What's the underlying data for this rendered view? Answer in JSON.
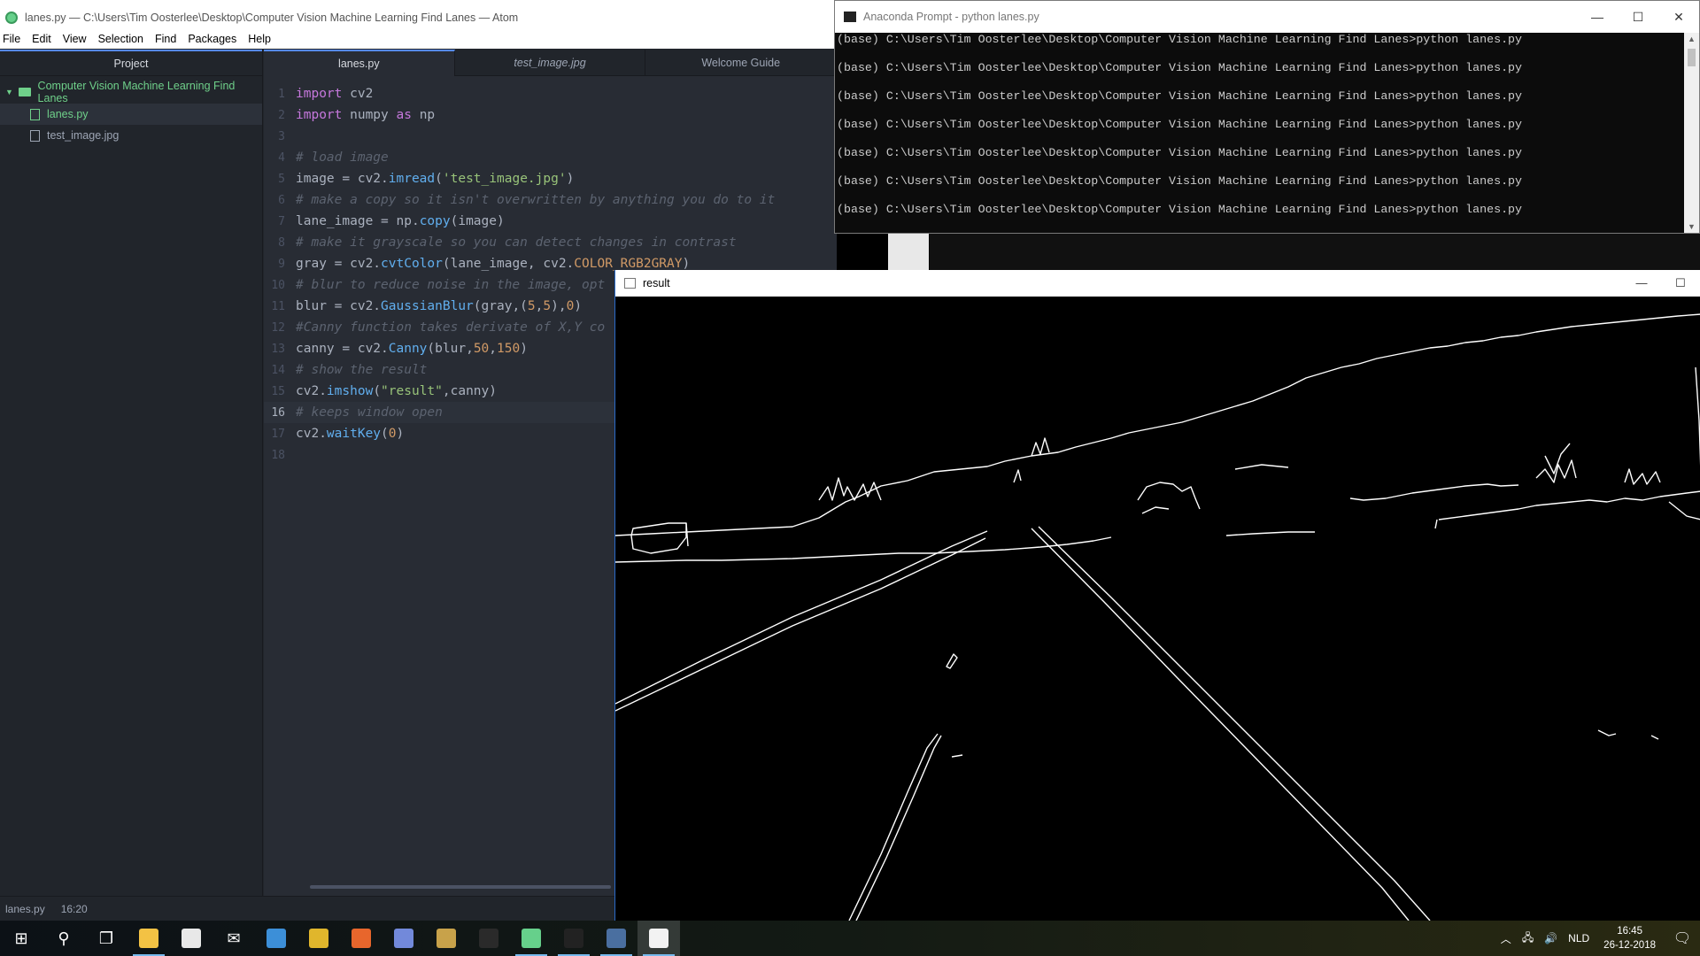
{
  "atom": {
    "title": "lanes.py — C:\\Users\\Tim Oosterlee\\Desktop\\Computer Vision Machine Learning Find Lanes — Atom",
    "menu": [
      "File",
      "Edit",
      "View",
      "Selection",
      "Find",
      "Packages",
      "Help"
    ],
    "tree": {
      "header": "Project",
      "root": "Computer Vision Machine Learning Find Lanes",
      "items": [
        {
          "label": "lanes.py",
          "selected": true
        },
        {
          "label": "test_image.jpg",
          "selected": false
        }
      ]
    },
    "tabs": [
      "lanes.py",
      "test_image.jpg",
      "Welcome Guide"
    ],
    "code": [
      [
        {
          "t": "kw",
          "v": "import"
        },
        {
          "t": "id",
          "v": " cv2"
        }
      ],
      [
        {
          "t": "kw",
          "v": "import"
        },
        {
          "t": "id",
          "v": " numpy "
        },
        {
          "t": "kw",
          "v": "as"
        },
        {
          "t": "id",
          "v": " np"
        }
      ],
      [],
      [
        {
          "t": "cmt",
          "v": "# load image"
        }
      ],
      [
        {
          "t": "id",
          "v": "image = cv2."
        },
        {
          "t": "fn",
          "v": "imread"
        },
        {
          "t": "id",
          "v": "("
        },
        {
          "t": "str",
          "v": "'test_image.jpg'"
        },
        {
          "t": "id",
          "v": ")"
        }
      ],
      [
        {
          "t": "cmt",
          "v": "# make a copy so it isn't overwritten by anything you do to it"
        }
      ],
      [
        {
          "t": "id",
          "v": "lane_image = np."
        },
        {
          "t": "fn",
          "v": "copy"
        },
        {
          "t": "id",
          "v": "(image)"
        }
      ],
      [
        {
          "t": "cmt",
          "v": "# make it grayscale so you can detect changes in contrast"
        }
      ],
      [
        {
          "t": "id",
          "v": "gray = cv2."
        },
        {
          "t": "fn",
          "v": "cvtColor"
        },
        {
          "t": "id",
          "v": "(lane_image, cv2."
        },
        {
          "t": "const",
          "v": "COLOR_RGB2GRAY"
        },
        {
          "t": "id",
          "v": ")"
        }
      ],
      [
        {
          "t": "cmt",
          "v": "# blur to reduce noise in the image, opt"
        }
      ],
      [
        {
          "t": "id",
          "v": "blur = cv2."
        },
        {
          "t": "fn",
          "v": "GaussianBlur"
        },
        {
          "t": "id",
          "v": "(gray,("
        },
        {
          "t": "num",
          "v": "5"
        },
        {
          "t": "id",
          "v": ","
        },
        {
          "t": "num",
          "v": "5"
        },
        {
          "t": "id",
          "v": "),"
        },
        {
          "t": "num",
          "v": "0"
        },
        {
          "t": "id",
          "v": ")"
        }
      ],
      [
        {
          "t": "cmt",
          "v": "#Canny function takes derivate of X,Y co"
        }
      ],
      [
        {
          "t": "id",
          "v": "canny = cv2."
        },
        {
          "t": "fn",
          "v": "Canny"
        },
        {
          "t": "id",
          "v": "(blur,"
        },
        {
          "t": "num",
          "v": "50"
        },
        {
          "t": "id",
          "v": ","
        },
        {
          "t": "num",
          "v": "150"
        },
        {
          "t": "id",
          "v": ")"
        }
      ],
      [
        {
          "t": "cmt",
          "v": "# show the result"
        }
      ],
      [
        {
          "t": "id",
          "v": "cv2."
        },
        {
          "t": "fn",
          "v": "imshow"
        },
        {
          "t": "id",
          "v": "("
        },
        {
          "t": "str",
          "v": "\"result\""
        },
        {
          "t": "id",
          "v": ",canny)"
        }
      ],
      [
        {
          "t": "cmt",
          "v": "# keeps window open"
        }
      ],
      [
        {
          "t": "id",
          "v": "cv2."
        },
        {
          "t": "fn",
          "v": "waitKey"
        },
        {
          "t": "id",
          "v": "("
        },
        {
          "t": "num",
          "v": "0"
        },
        {
          "t": "id",
          "v": ")"
        }
      ],
      []
    ],
    "cursor_line": 16,
    "status": {
      "file": "lanes.py",
      "position": "16:20"
    }
  },
  "conda": {
    "title": "Anaconda Prompt - python  lanes.py",
    "lines": [
      "(base) C:\\Users\\Tim Oosterlee\\Desktop\\Computer Vision Machine Learning Find Lanes>python lanes.py",
      "(base) C:\\Users\\Tim Oosterlee\\Desktop\\Computer Vision Machine Learning Find Lanes>python lanes.py",
      "(base) C:\\Users\\Tim Oosterlee\\Desktop\\Computer Vision Machine Learning Find Lanes>python lanes.py",
      "(base) C:\\Users\\Tim Oosterlee\\Desktop\\Computer Vision Machine Learning Find Lanes>python lanes.py",
      "(base) C:\\Users\\Tim Oosterlee\\Desktop\\Computer Vision Machine Learning Find Lanes>python lanes.py",
      "(base) C:\\Users\\Tim Oosterlee\\Desktop\\Computer Vision Machine Learning Find Lanes>python lanes.py",
      "(base) C:\\Users\\Tim Oosterlee\\Desktop\\Computer Vision Machine Learning Find Lanes>python lanes.py"
    ]
  },
  "result": {
    "title": "result"
  },
  "taskbar": {
    "apps": [
      {
        "name": "start-icon",
        "glyph": "⊞"
      },
      {
        "name": "search-icon",
        "glyph": "⚲"
      },
      {
        "name": "task-view-icon",
        "glyph": "❐"
      },
      {
        "name": "file-explorer-icon",
        "color": "#f3c244",
        "running": true
      },
      {
        "name": "store-icon",
        "color": "#e8e8e8"
      },
      {
        "name": "mail-icon",
        "glyph": "✉"
      },
      {
        "name": "visual-studio-icon",
        "color": "#3c8fd8"
      },
      {
        "name": "chrome-icon",
        "color": "#e0b62c"
      },
      {
        "name": "firefox-icon",
        "color": "#e8662c"
      },
      {
        "name": "discord-icon",
        "color": "#7289da"
      },
      {
        "name": "league-icon",
        "color": "#c8a24a"
      },
      {
        "name": "r-icon",
        "color": "#2a2a2a"
      },
      {
        "name": "atom-icon",
        "color": "#66d08b",
        "running": true
      },
      {
        "name": "terminal-icon",
        "color": "#222222",
        "running": true
      },
      {
        "name": "image-viewer-icon",
        "color": "#4a6fa0",
        "running": true
      },
      {
        "name": "result-window-icon",
        "color": "#f2f2f2",
        "running": true,
        "active": true
      }
    ],
    "language": "NLD",
    "time": "16:45",
    "date": "26-12-2018"
  }
}
